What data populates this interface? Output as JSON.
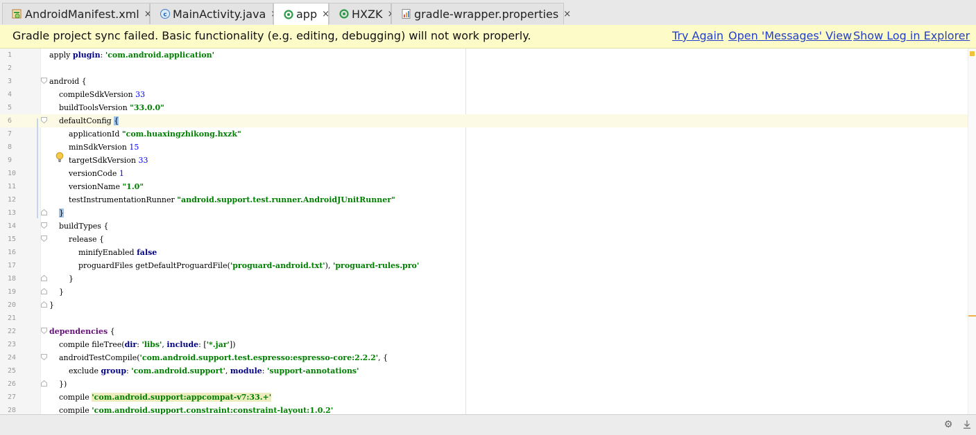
{
  "tabs": [
    {
      "label": "AndroidManifest.xml",
      "icon": "xml-manifest-icon",
      "active": false,
      "close": "×"
    },
    {
      "label": "MainActivity.java",
      "icon": "java-class-icon",
      "active": false,
      "close": "×"
    },
    {
      "label": "app",
      "icon": "gradle-module-icon",
      "active": true,
      "close": "×"
    },
    {
      "label": "HXZK",
      "icon": "gradle-module-icon",
      "active": false,
      "close": "×"
    },
    {
      "label": "gradle-wrapper.properties",
      "icon": "properties-file-icon",
      "active": false,
      "close": "×"
    }
  ],
  "notification": {
    "message": "Gradle project sync failed. Basic functionality (e.g. editing, debugging) will not work properly.",
    "try_again": "Try Again",
    "open_messages": "Open 'Messages' View",
    "show_log": "Show Log in Explorer"
  },
  "editor": {
    "lines": [
      {
        "n": "1",
        "parts": [
          [
            "apply ",
            ""
          ],
          [
            "plugin",
            "kw"
          ],
          [
            ": ",
            ""
          ],
          [
            "'com.android.application'",
            "str"
          ]
        ]
      },
      {
        "n": "2",
        "parts": []
      },
      {
        "n": "3",
        "parts": [
          [
            "android {",
            ""
          ]
        ]
      },
      {
        "n": "4",
        "parts": [
          [
            "    compileSdkVersion ",
            ""
          ],
          [
            "33",
            "num"
          ]
        ]
      },
      {
        "n": "5",
        "parts": [
          [
            "    buildToolsVersion ",
            ""
          ],
          [
            "\"33.0.0\"",
            "str"
          ]
        ]
      },
      {
        "n": "6",
        "parts": [
          [
            "    defaultConfig ",
            ""
          ],
          [
            "{",
            "brace"
          ]
        ],
        "current": true
      },
      {
        "n": "7",
        "parts": [
          [
            "        applicationId ",
            ""
          ],
          [
            "\"com.huaxingzhikong.hxzk\"",
            "str"
          ]
        ]
      },
      {
        "n": "8",
        "parts": [
          [
            "        minSdkVersion ",
            ""
          ],
          [
            "15",
            "num"
          ]
        ]
      },
      {
        "n": "9",
        "parts": [
          [
            "        targetSdkVersion ",
            ""
          ],
          [
            "33",
            "num"
          ]
        ]
      },
      {
        "n": "10",
        "parts": [
          [
            "        versionCode ",
            ""
          ],
          [
            "1",
            "num"
          ]
        ]
      },
      {
        "n": "11",
        "parts": [
          [
            "        versionName ",
            ""
          ],
          [
            "\"1.0\"",
            "str"
          ]
        ]
      },
      {
        "n": "12",
        "parts": [
          [
            "        testInstrumentationRunner ",
            ""
          ],
          [
            "\"android.support.test.runner.AndroidJUnitRunner\"",
            "str"
          ]
        ]
      },
      {
        "n": "13",
        "parts": [
          [
            "    ",
            ""
          ],
          [
            "}",
            "brace"
          ]
        ]
      },
      {
        "n": "14",
        "parts": [
          [
            "    buildTypes {",
            ""
          ]
        ]
      },
      {
        "n": "15",
        "parts": [
          [
            "        release {",
            ""
          ]
        ]
      },
      {
        "n": "16",
        "parts": [
          [
            "            minifyEnabled ",
            ""
          ],
          [
            "false",
            "kw"
          ]
        ]
      },
      {
        "n": "17",
        "parts": [
          [
            "            proguardFiles getDefaultProguardFile(",
            ""
          ],
          [
            "'proguard-android.txt'",
            "str"
          ],
          [
            "), ",
            ""
          ],
          [
            "'proguard-rules.pro'",
            "str"
          ]
        ]
      },
      {
        "n": "18",
        "parts": [
          [
            "        }",
            ""
          ]
        ]
      },
      {
        "n": "19",
        "parts": [
          [
            "    }",
            ""
          ]
        ]
      },
      {
        "n": "20",
        "parts": [
          [
            "}",
            ""
          ]
        ]
      },
      {
        "n": "21",
        "parts": []
      },
      {
        "n": "22",
        "parts": [
          [
            "dependencies",
            "kwp"
          ],
          [
            " {",
            ""
          ]
        ]
      },
      {
        "n": "23",
        "parts": [
          [
            "    compile fileTree(",
            ""
          ],
          [
            "dir",
            "kw"
          ],
          [
            ": ",
            ""
          ],
          [
            "'libs'",
            "str"
          ],
          [
            ", ",
            ""
          ],
          [
            "include",
            "kw"
          ],
          [
            ": [",
            ""
          ],
          [
            "'*.jar'",
            "str"
          ],
          [
            "])",
            ""
          ]
        ]
      },
      {
        "n": "24",
        "parts": [
          [
            "    androidTestCompile(",
            ""
          ],
          [
            "'com.android.support.test.espresso:espresso-core:2.2.2'",
            "str"
          ],
          [
            ", {",
            ""
          ]
        ]
      },
      {
        "n": "25",
        "parts": [
          [
            "        exclude ",
            ""
          ],
          [
            "group",
            "kw"
          ],
          [
            ": ",
            ""
          ],
          [
            "'com.android.support'",
            "str"
          ],
          [
            ", ",
            ""
          ],
          [
            "module",
            "kw"
          ],
          [
            ": ",
            ""
          ],
          [
            "'support-annotations'",
            "str"
          ]
        ]
      },
      {
        "n": "26",
        "parts": [
          [
            "    })",
            ""
          ]
        ]
      },
      {
        "n": "27",
        "parts": [
          [
            "    compile ",
            ""
          ],
          [
            "'com.android.support:appcompat-v7:33.+'",
            "strhl"
          ]
        ]
      },
      {
        "n": "28",
        "parts": [
          [
            "    compile ",
            ""
          ],
          [
            "'com.android.support.constraint:constraint-layout:1.0.2'",
            "str"
          ]
        ]
      }
    ]
  },
  "status": {
    "settings_icon": "settings-gear-icon",
    "download_icon": "download-icon"
  }
}
